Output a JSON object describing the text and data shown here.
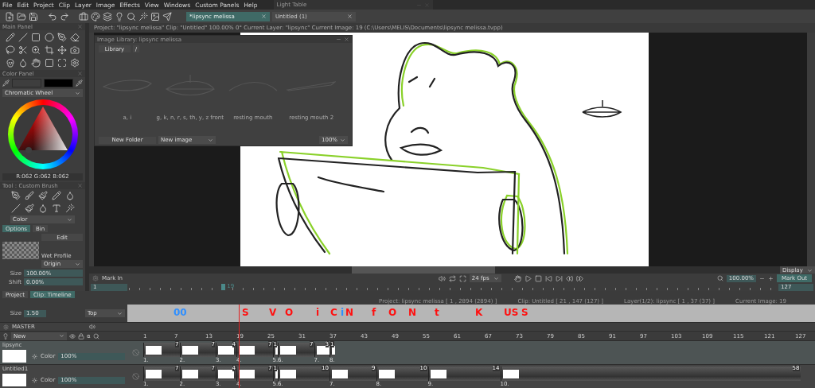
{
  "menu": [
    "File",
    "Edit",
    "Project",
    "Clip",
    "Layer",
    "Image",
    "Effects",
    "View",
    "Windows",
    "Custom Panels",
    "Help"
  ],
  "light_table": {
    "title": "Light Table"
  },
  "document_tabs": [
    {
      "label": "*lipsync melissa",
      "selected": true
    },
    {
      "label": "Untitled (1)",
      "selected": false
    }
  ],
  "main_panel": {
    "title": "Main Panel"
  },
  "status_line": "Project: \"lipsync melissa\"  Clip: \"Untitled\"   100.00%   0°   Current Layer: \"lipsync\"   Current Image: 19 (C:\\Users\\MELIS\\Documents\\lipsync melissa.tvpp)",
  "color_panel": {
    "title": "Color Panel",
    "mode": "Chromatic Wheel",
    "readout": "R:062 G:062 B:062"
  },
  "tool_panel": {
    "title": "Tool : Custom Brush",
    "mode": "Color",
    "tabs": [
      {
        "label": "Options",
        "selected": true
      },
      {
        "label": "Bin",
        "selected": false
      }
    ],
    "edit": "Edit",
    "profile": "Wet Profile",
    "origin": "Origin",
    "fields": [
      {
        "label": "Size",
        "value": "100.00%"
      },
      {
        "label": "Shift",
        "value": "0.00%"
      }
    ]
  },
  "image_library": {
    "title": "Image Library: lipsync melissa",
    "tabs": [
      "Library",
      "/"
    ],
    "items": [
      "a, i",
      "g, k, n, r, s, th, y, z front",
      "resting mouth",
      "resting mouth 2"
    ],
    "new_folder": "New Folder",
    "new_image": "New image",
    "zoom": "100%"
  },
  "playback": {
    "mark_in": "Mark In",
    "fps": "24 fps",
    "zoom": "100.00%",
    "display": "Display",
    "mark_out": "Mark Out",
    "start": "1",
    "end": "127",
    "current": "19"
  },
  "timeline": {
    "tabs": [
      {
        "label": "Project",
        "selected": false
      },
      {
        "label": "Clip: Timeline",
        "selected": true
      }
    ],
    "size_label": "Size",
    "size": "1.50",
    "position": "Top",
    "info": [
      "Project: lipsync melissa [ 1 , 2894  (2894) ]",
      "Clip: Untitled [ 21 , 147  (127) ]",
      "Layer(1/2): lipsync [ 1 , 37  (37) ]",
      "Current Image: 19"
    ],
    "annotations": [
      {
        "text": "00",
        "color": "#2f8fff"
      },
      {
        "text": "S",
        "color": "#ff1010"
      },
      {
        "text": "V",
        "color": "#ff1010"
      },
      {
        "text": "O",
        "color": "#ff1010"
      },
      {
        "text": "i",
        "color": "#ff1010"
      },
      {
        "text": "C",
        "color": "#ff1010"
      },
      {
        "text": "i",
        "color": "#2f8fff"
      },
      {
        "text": "N",
        "color": "#ff1010"
      },
      {
        "text": "f",
        "color": "#ff1010"
      },
      {
        "text": "O",
        "color": "#ff1010"
      },
      {
        "text": "N",
        "color": "#ff1010"
      },
      {
        "text": "t",
        "color": "#ff1010"
      },
      {
        "text": "K",
        "color": "#ff1010"
      },
      {
        "text": "US",
        "color": "#ff1010"
      },
      {
        "text": "S",
        "color": "#ff1010"
      }
    ],
    "master": "MASTER",
    "group": "New",
    "alpha": "α",
    "ruler": [
      "1",
      "7",
      "13",
      "19",
      "25",
      "31",
      "37",
      "43",
      "49",
      "55",
      "61",
      "67",
      "73",
      "79",
      "85",
      "91",
      "97",
      "103",
      "109",
      "115",
      "121",
      "127"
    ],
    "layers": [
      {
        "name": "lipsync",
        "selected": true,
        "color_label": "Color",
        "opacity": "100%",
        "instances": [
          {
            "number": "1.",
            "duration": "7"
          },
          {
            "number": "2.",
            "duration": "7"
          },
          {
            "number": "3.",
            "duration": "4"
          },
          {
            "number": "4.",
            "duration": "7"
          },
          {
            "number": "5.",
            "duration": "1"
          },
          {
            "number": "6.",
            "duration": "7"
          },
          {
            "number": "7.",
            "duration": "3"
          },
          {
            "number": "8.",
            "duration": "1"
          }
        ]
      },
      {
        "name": "Untitled1",
        "selected": false,
        "color_label": "Color",
        "opacity": "100%",
        "instances": [
          {
            "number": "1.",
            "duration": "7"
          },
          {
            "number": "2.",
            "duration": "7"
          },
          {
            "number": "3.",
            "duration": "4"
          },
          {
            "number": "4.",
            "duration": "7"
          },
          {
            "number": "5.",
            "duration": "1"
          },
          {
            "number": "6.",
            "duration": "10"
          },
          {
            "number": "7.",
            "duration": "9"
          },
          {
            "number": "8.",
            "duration": "10"
          },
          {
            "number": "9.",
            "duration": "14"
          },
          {
            "number": "10.",
            "duration": "58"
          }
        ]
      }
    ]
  }
}
